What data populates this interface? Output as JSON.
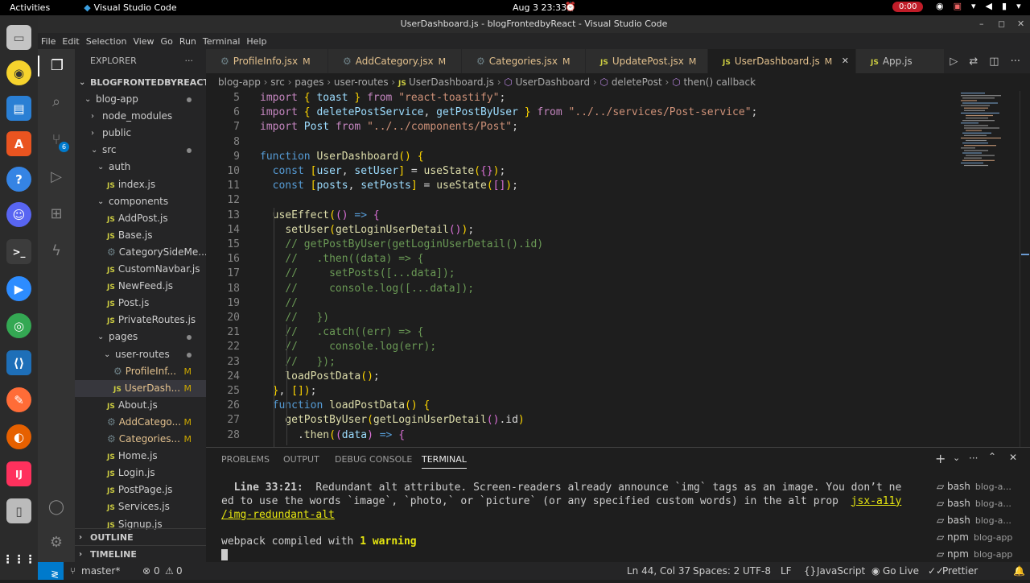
{
  "os_bar": {
    "activities": "Activities",
    "app_name": "Visual Studio Code",
    "clock": "Aug 3  23:33",
    "record": "0:00"
  },
  "window": {
    "title": "UserDashboard.js - blogFrontedbyReact - Visual Studio Code"
  },
  "menu": [
    "File",
    "Edit",
    "Selection",
    "View",
    "Go",
    "Run",
    "Terminal",
    "Help"
  ],
  "activity_badge": "6",
  "explorer": {
    "header": "EXPLORER",
    "root": "BLOGFRONTEDBYREACT",
    "items": [
      {
        "label": "blog-app",
        "kind": "folder-open"
      },
      {
        "label": "node_modules",
        "kind": "folder"
      },
      {
        "label": "public",
        "kind": "folder"
      },
      {
        "label": "src",
        "kind": "folder-open"
      },
      {
        "label": "auth",
        "kind": "folder-open"
      },
      {
        "label": "index.js",
        "kind": "js"
      },
      {
        "label": "components",
        "kind": "folder-open"
      },
      {
        "label": "AddPost.js",
        "kind": "js"
      },
      {
        "label": "Base.js",
        "kind": "js"
      },
      {
        "label": "CategorySideMe...",
        "kind": "gear"
      },
      {
        "label": "CustomNavbar.js",
        "kind": "js"
      },
      {
        "label": "NewFeed.js",
        "kind": "js"
      },
      {
        "label": "Post.js",
        "kind": "js"
      },
      {
        "label": "PrivateRoutes.js",
        "kind": "js"
      },
      {
        "label": "pages",
        "kind": "folder-open"
      },
      {
        "label": "user-routes",
        "kind": "folder-open"
      },
      {
        "label": "ProfileInf...",
        "kind": "gear",
        "badge": "M"
      },
      {
        "label": "UserDash...",
        "kind": "js",
        "badge": "M"
      },
      {
        "label": "About.js",
        "kind": "js"
      },
      {
        "label": "AddCatego...",
        "kind": "gear",
        "badge": "M"
      },
      {
        "label": "Categories...",
        "kind": "gear",
        "badge": "M"
      },
      {
        "label": "Home.js",
        "kind": "js"
      },
      {
        "label": "Login.js",
        "kind": "js"
      },
      {
        "label": "PostPage.js",
        "kind": "js"
      },
      {
        "label": "Services.js",
        "kind": "js"
      },
      {
        "label": "Signup.js",
        "kind": "js"
      }
    ],
    "outline": "OUTLINE",
    "timeline": "TIMELINE"
  },
  "tabs": [
    {
      "label": "ProfileInfo.jsx",
      "icon": "gear",
      "badge": "M"
    },
    {
      "label": "AddCategory.jsx",
      "icon": "gear",
      "badge": "M"
    },
    {
      "label": "Categories.jsx",
      "icon": "gear",
      "badge": "M"
    },
    {
      "label": "UpdatePost.jsx",
      "icon": "js",
      "badge": "M"
    },
    {
      "label": "UserDashboard.js",
      "icon": "js",
      "badge": "M",
      "active": true
    },
    {
      "label": "App.js",
      "icon": "js",
      "badge": ""
    }
  ],
  "breadcrumb": [
    "blog-app",
    "src",
    "pages",
    "user-routes",
    "UserDashboard.js",
    "UserDashboard",
    "deletePost",
    "then() callback"
  ],
  "code_lines": [
    {
      "n": "5",
      "code": "import { toast } from \"react-toastify\";"
    },
    {
      "n": "6",
      "code": "import { deletePostService, getPostByUser } from \"../../services/Post-service\";"
    },
    {
      "n": "7",
      "code": "import Post from \"../../components/Post\";"
    },
    {
      "n": "8",
      "code": ""
    },
    {
      "n": "9",
      "code": "function UserDashboard() {"
    },
    {
      "n": "10",
      "code": "  const [user, setUser] = useState({});"
    },
    {
      "n": "11",
      "code": "  const [posts, setPosts] = useState([]);"
    },
    {
      "n": "12",
      "code": ""
    },
    {
      "n": "13",
      "code": "  useEffect(() => {"
    },
    {
      "n": "14",
      "code": "    setUser(getLoginUserDetail());"
    },
    {
      "n": "15",
      "code": "    // getPostByUser(getLoginUserDetail().id)"
    },
    {
      "n": "16",
      "code": "    //   .then((data) => {"
    },
    {
      "n": "17",
      "code": "    //     setPosts([...data]);"
    },
    {
      "n": "18",
      "code": "    //     console.log([...data]);"
    },
    {
      "n": "19",
      "code": "    //"
    },
    {
      "n": "20",
      "code": "    //   })"
    },
    {
      "n": "21",
      "code": "    //   .catch((err) => {"
    },
    {
      "n": "22",
      "code": "    //     console.log(err);"
    },
    {
      "n": "23",
      "code": "    //   });"
    },
    {
      "n": "24",
      "code": "    loadPostData();"
    },
    {
      "n": "25",
      "code": "  }, []);"
    },
    {
      "n": "26",
      "code": "  function loadPostData() {"
    },
    {
      "n": "27",
      "code": "    getPostByUser(getLoginUserDetail().id)"
    },
    {
      "n": "28",
      "code": "      .then((data) => {"
    }
  ],
  "panel": {
    "tabs": [
      "PROBLEMS",
      "OUTPUT",
      "DEBUG CONSOLE",
      "TERMINAL"
    ],
    "active_tab": "TERMINAL",
    "terminal_lines": [
      "  Line 33:21:  Redundant alt attribute. Screen-readers already announce `img` tags as an image. You don’t ne",
      "ed to use the words `image`, `photo,` or `picture` (or any specified custom words) in the alt prop  jsx-a11y",
      "/img-redundant-alt",
      "",
      "webpack compiled with 1 warning"
    ],
    "terminal_list": [
      {
        "name": "bash",
        "sub": "blog-a..."
      },
      {
        "name": "bash",
        "sub": "blog-a..."
      },
      {
        "name": "bash",
        "sub": "blog-a..."
      },
      {
        "name": "npm",
        "sub": "blog-app"
      },
      {
        "name": "npm",
        "sub": "blog-app"
      },
      {
        "name": "npm",
        "sub": "blog-app"
      }
    ]
  },
  "status": {
    "branch": "master*",
    "errors": "0",
    "warnings": "0",
    "position": "Ln 44, Col 37",
    "spaces": "Spaces: 2",
    "encoding": "UTF-8",
    "eol": "LF",
    "language": "JavaScript",
    "golive": "Go Live",
    "prettier": "Prettier"
  },
  "colors": {
    "accent": "#007acc",
    "modified": "#e2c08d",
    "keyword": "#569cd6",
    "string": "#ce9178",
    "comment": "#6a9955"
  }
}
